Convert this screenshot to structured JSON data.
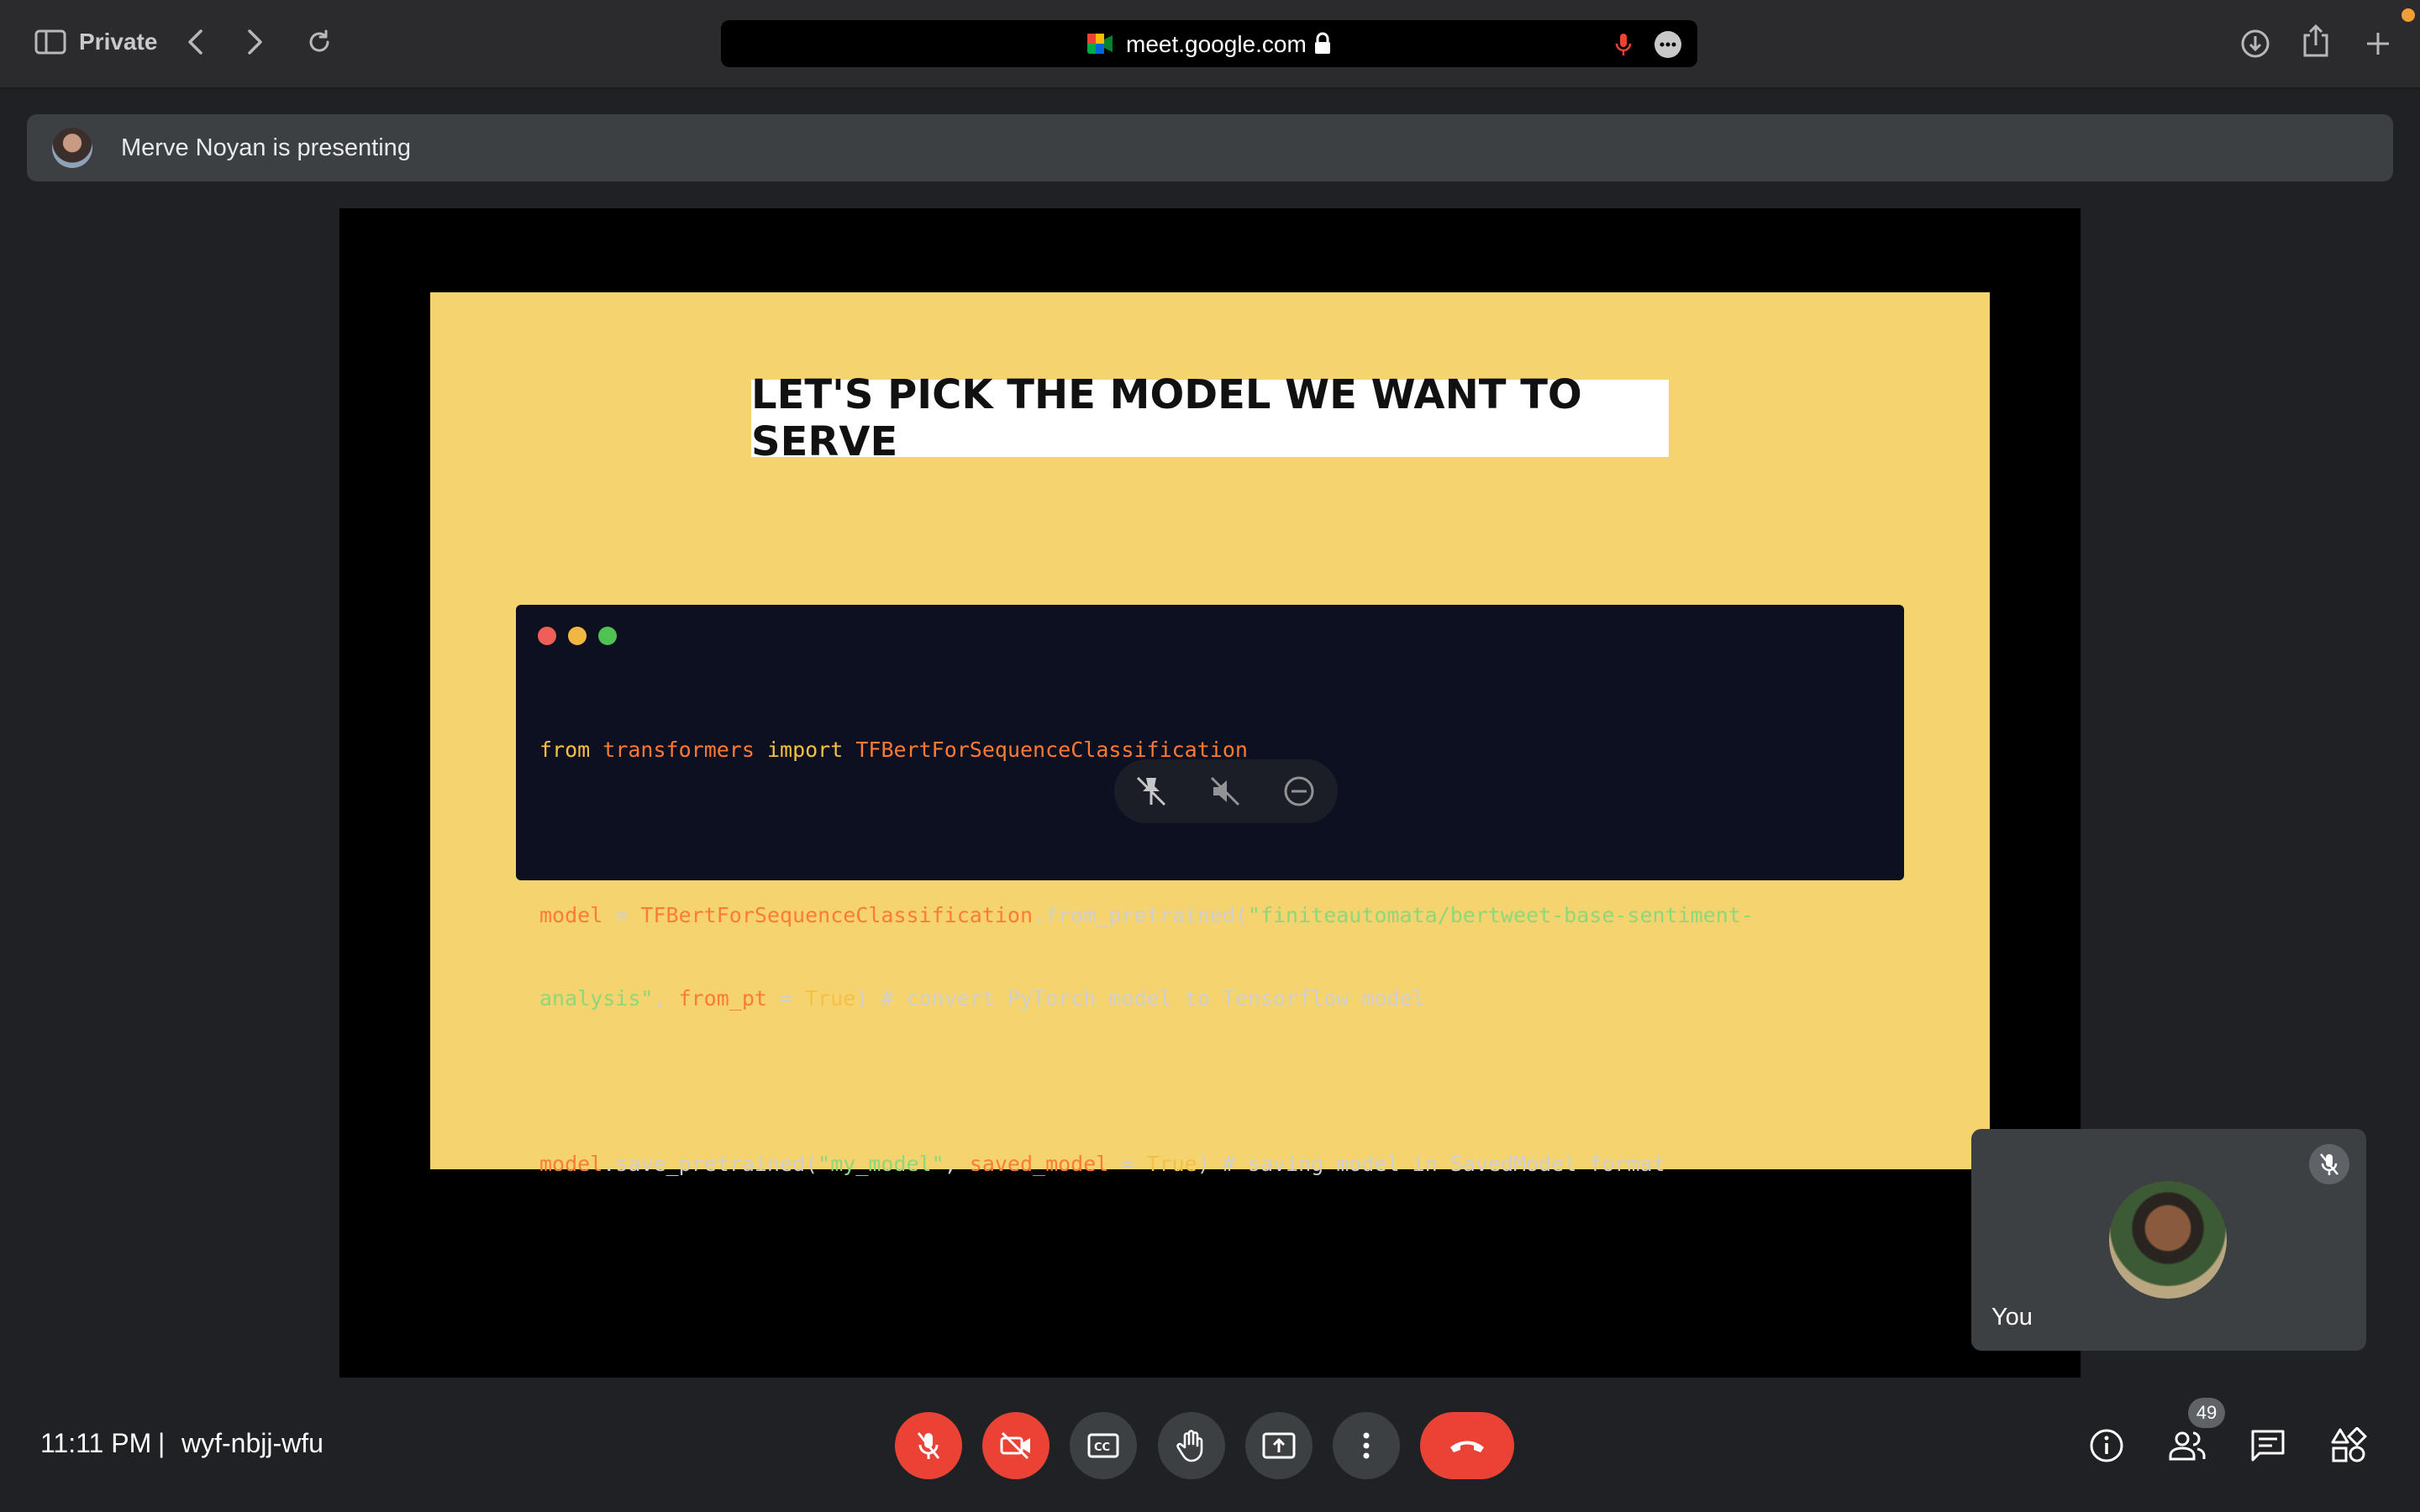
{
  "browser": {
    "mode_label": "Private",
    "url": "meet.google.com"
  },
  "banner": {
    "presenter_text": "Merve Noyan is presenting"
  },
  "slide": {
    "title": "LET'S PICK THE MODEL WE WANT TO SERVE",
    "code": {
      "line1": {
        "kw1": "from",
        "mod": "transformers",
        "kw2": "import",
        "cls": "TFBertForSequenceClassification"
      },
      "line2": {
        "var": "model",
        "eq": " = ",
        "cls": "TFBertForSequenceClassification",
        "method": ".from_pretrained(",
        "str": "\"finiteautomata/bertweet-base-sentiment-"
      },
      "line3": {
        "str": "analysis\"",
        "sep": ", ",
        "arg": "from_pt",
        "eq": " = ",
        "val": "True",
        "rest": ") # convert PyTorch model to Tensorflow model"
      },
      "line4": {
        "var": "model",
        "method": ".save_pretrained(",
        "str": "\"my_model\"",
        "sep": ", ",
        "arg": "saved_model",
        "eq": " = ",
        "val": "True",
        "rest": ") # saving model in SavedModel format"
      }
    }
  },
  "self_tile": {
    "label": "You"
  },
  "meeting": {
    "time": "11:11 PM",
    "separator": "|",
    "code": "wyf-nbjj-wfu",
    "participant_count": "49"
  },
  "colors": {
    "danger": "#ea4335",
    "slide_bg": "#f5d470",
    "surface": "#3c4043"
  }
}
